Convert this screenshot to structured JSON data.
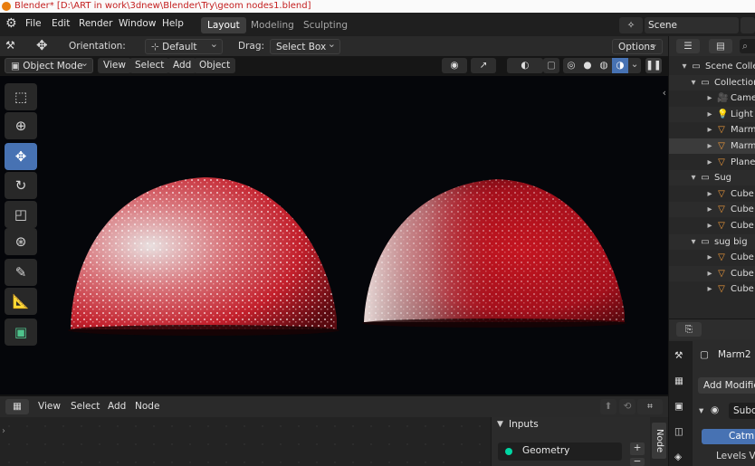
{
  "window_title": "Blender* [D:\\ART in work\\3dnew\\Blender\\Try\\geom nodes1.blend]",
  "topbar": {
    "menus": [
      "File",
      "Edit",
      "Render",
      "Window",
      "Help"
    ],
    "workspaces": [
      "Layout",
      "Modeling",
      "Sculpting"
    ],
    "active_workspace": "Layout",
    "scene_label": "Scene"
  },
  "viewport_header": {
    "orientation_label": "Orientation:",
    "orientation_value": "Default",
    "drag_label": "Drag:",
    "drag_value": "Select Box",
    "options_label": "Options",
    "mode": "Object Mode",
    "menus": [
      "View",
      "Select",
      "Add",
      "Object"
    ]
  },
  "toolbar": {
    "tools": [
      "select-box-icon",
      "cursor-icon",
      "move-icon",
      "rotate-icon",
      "scale-icon",
      "transform-icon",
      "annotate-icon",
      "measure-icon",
      "add-cube-icon"
    ],
    "active_tool": "move-icon"
  },
  "outliner": {
    "rows": [
      {
        "label": "Scene Collec",
        "indent": 0,
        "icon": "collection-icon"
      },
      {
        "label": "Collection",
        "indent": 1,
        "icon": "collection-icon"
      },
      {
        "label": "Came",
        "indent": 2,
        "icon": "camera-icon"
      },
      {
        "label": "Light",
        "indent": 2,
        "icon": "light-icon"
      },
      {
        "label": "Marm",
        "indent": 2,
        "icon": "mesh-icon"
      },
      {
        "label": "Marm",
        "indent": 2,
        "icon": "mesh-icon",
        "selected": true
      },
      {
        "label": "Plane",
        "indent": 2,
        "icon": "mesh-icon"
      },
      {
        "label": "Sug",
        "indent": 1,
        "icon": "collection-icon"
      },
      {
        "label": "Cube",
        "indent": 2,
        "icon": "mesh-icon"
      },
      {
        "label": "Cube",
        "indent": 2,
        "icon": "mesh-icon"
      },
      {
        "label": "Cube",
        "indent": 2,
        "icon": "mesh-icon"
      },
      {
        "label": "sug big",
        "indent": 1,
        "icon": "collection-icon"
      },
      {
        "label": "Cube",
        "indent": 2,
        "icon": "mesh-icon"
      },
      {
        "label": "Cube",
        "indent": 2,
        "icon": "mesh-icon"
      },
      {
        "label": "Cube",
        "indent": 2,
        "icon": "mesh-icon"
      }
    ]
  },
  "properties": {
    "object_name": "Marm2",
    "add_modifier": "Add Modifier",
    "modifier_name": "Subd",
    "catmull": "Catmu",
    "levels": "Levels Vie"
  },
  "node_editor": {
    "menus": [
      "View",
      "Select",
      "Add",
      "Node"
    ],
    "inputs_label": "Inputs",
    "geometry_label": "Geometry",
    "side_tab": "Node"
  },
  "colors": {
    "accent": "#4772b3",
    "title_text": "#c42020",
    "mesh_icon": "#f09a3a",
    "geometry_socket": "#00d6a3"
  }
}
